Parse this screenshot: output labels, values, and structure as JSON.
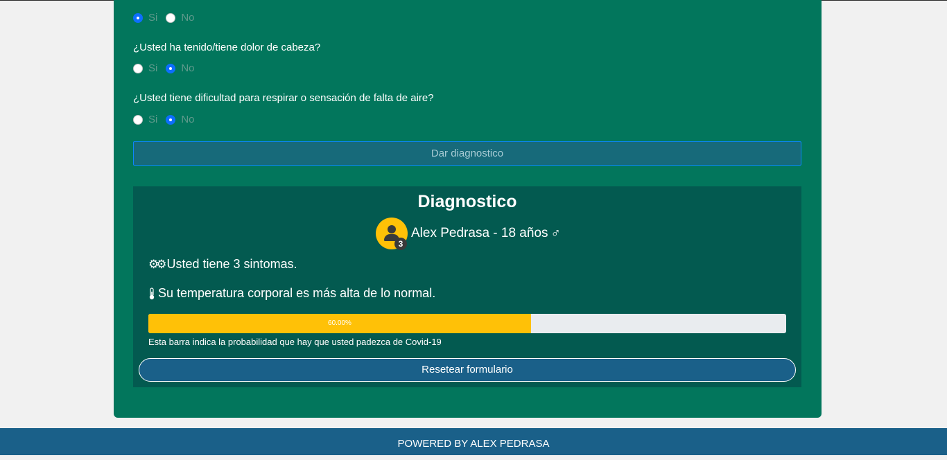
{
  "form": {
    "questions": [
      {
        "text": "",
        "yes_label": "Si",
        "no_label": "No",
        "selected": "yes"
      },
      {
        "text": "¿Usted ha tenido/tiene dolor de cabeza?",
        "yes_label": "Si",
        "no_label": "No",
        "selected": "no"
      },
      {
        "text": "¿Usted tiene dificultad para respirar o sensación de falta de aire?",
        "yes_label": "Si",
        "no_label": "No",
        "selected": "no"
      }
    ],
    "submit_label": "Dar diagnostico"
  },
  "diagnosis": {
    "title": "Diagnostico",
    "symptom_count": "3",
    "user_text": "Alex Pedrasa - 18 años",
    "gender_icon": "male-icon",
    "symptoms_text": "Usted tiene 3 sintomas.",
    "temperature_text": "Su temperatura corporal es más alta de lo normal.",
    "probability": 0.6,
    "probability_label": "60.00%",
    "probability_caption": "Esta barra indica la probabilidad que hay que usted padezca de Covid-19",
    "reset_label": "Resetear formulario"
  },
  "footer": {
    "text": "POWERED BY ALEX PEDRASA"
  },
  "colors": {
    "card_bg": "#02765c",
    "result_bg": "#035a50",
    "accent_yellow": "#ffc107",
    "footer_bg": "#1a6089",
    "radio_selected": "#0d6efd"
  }
}
